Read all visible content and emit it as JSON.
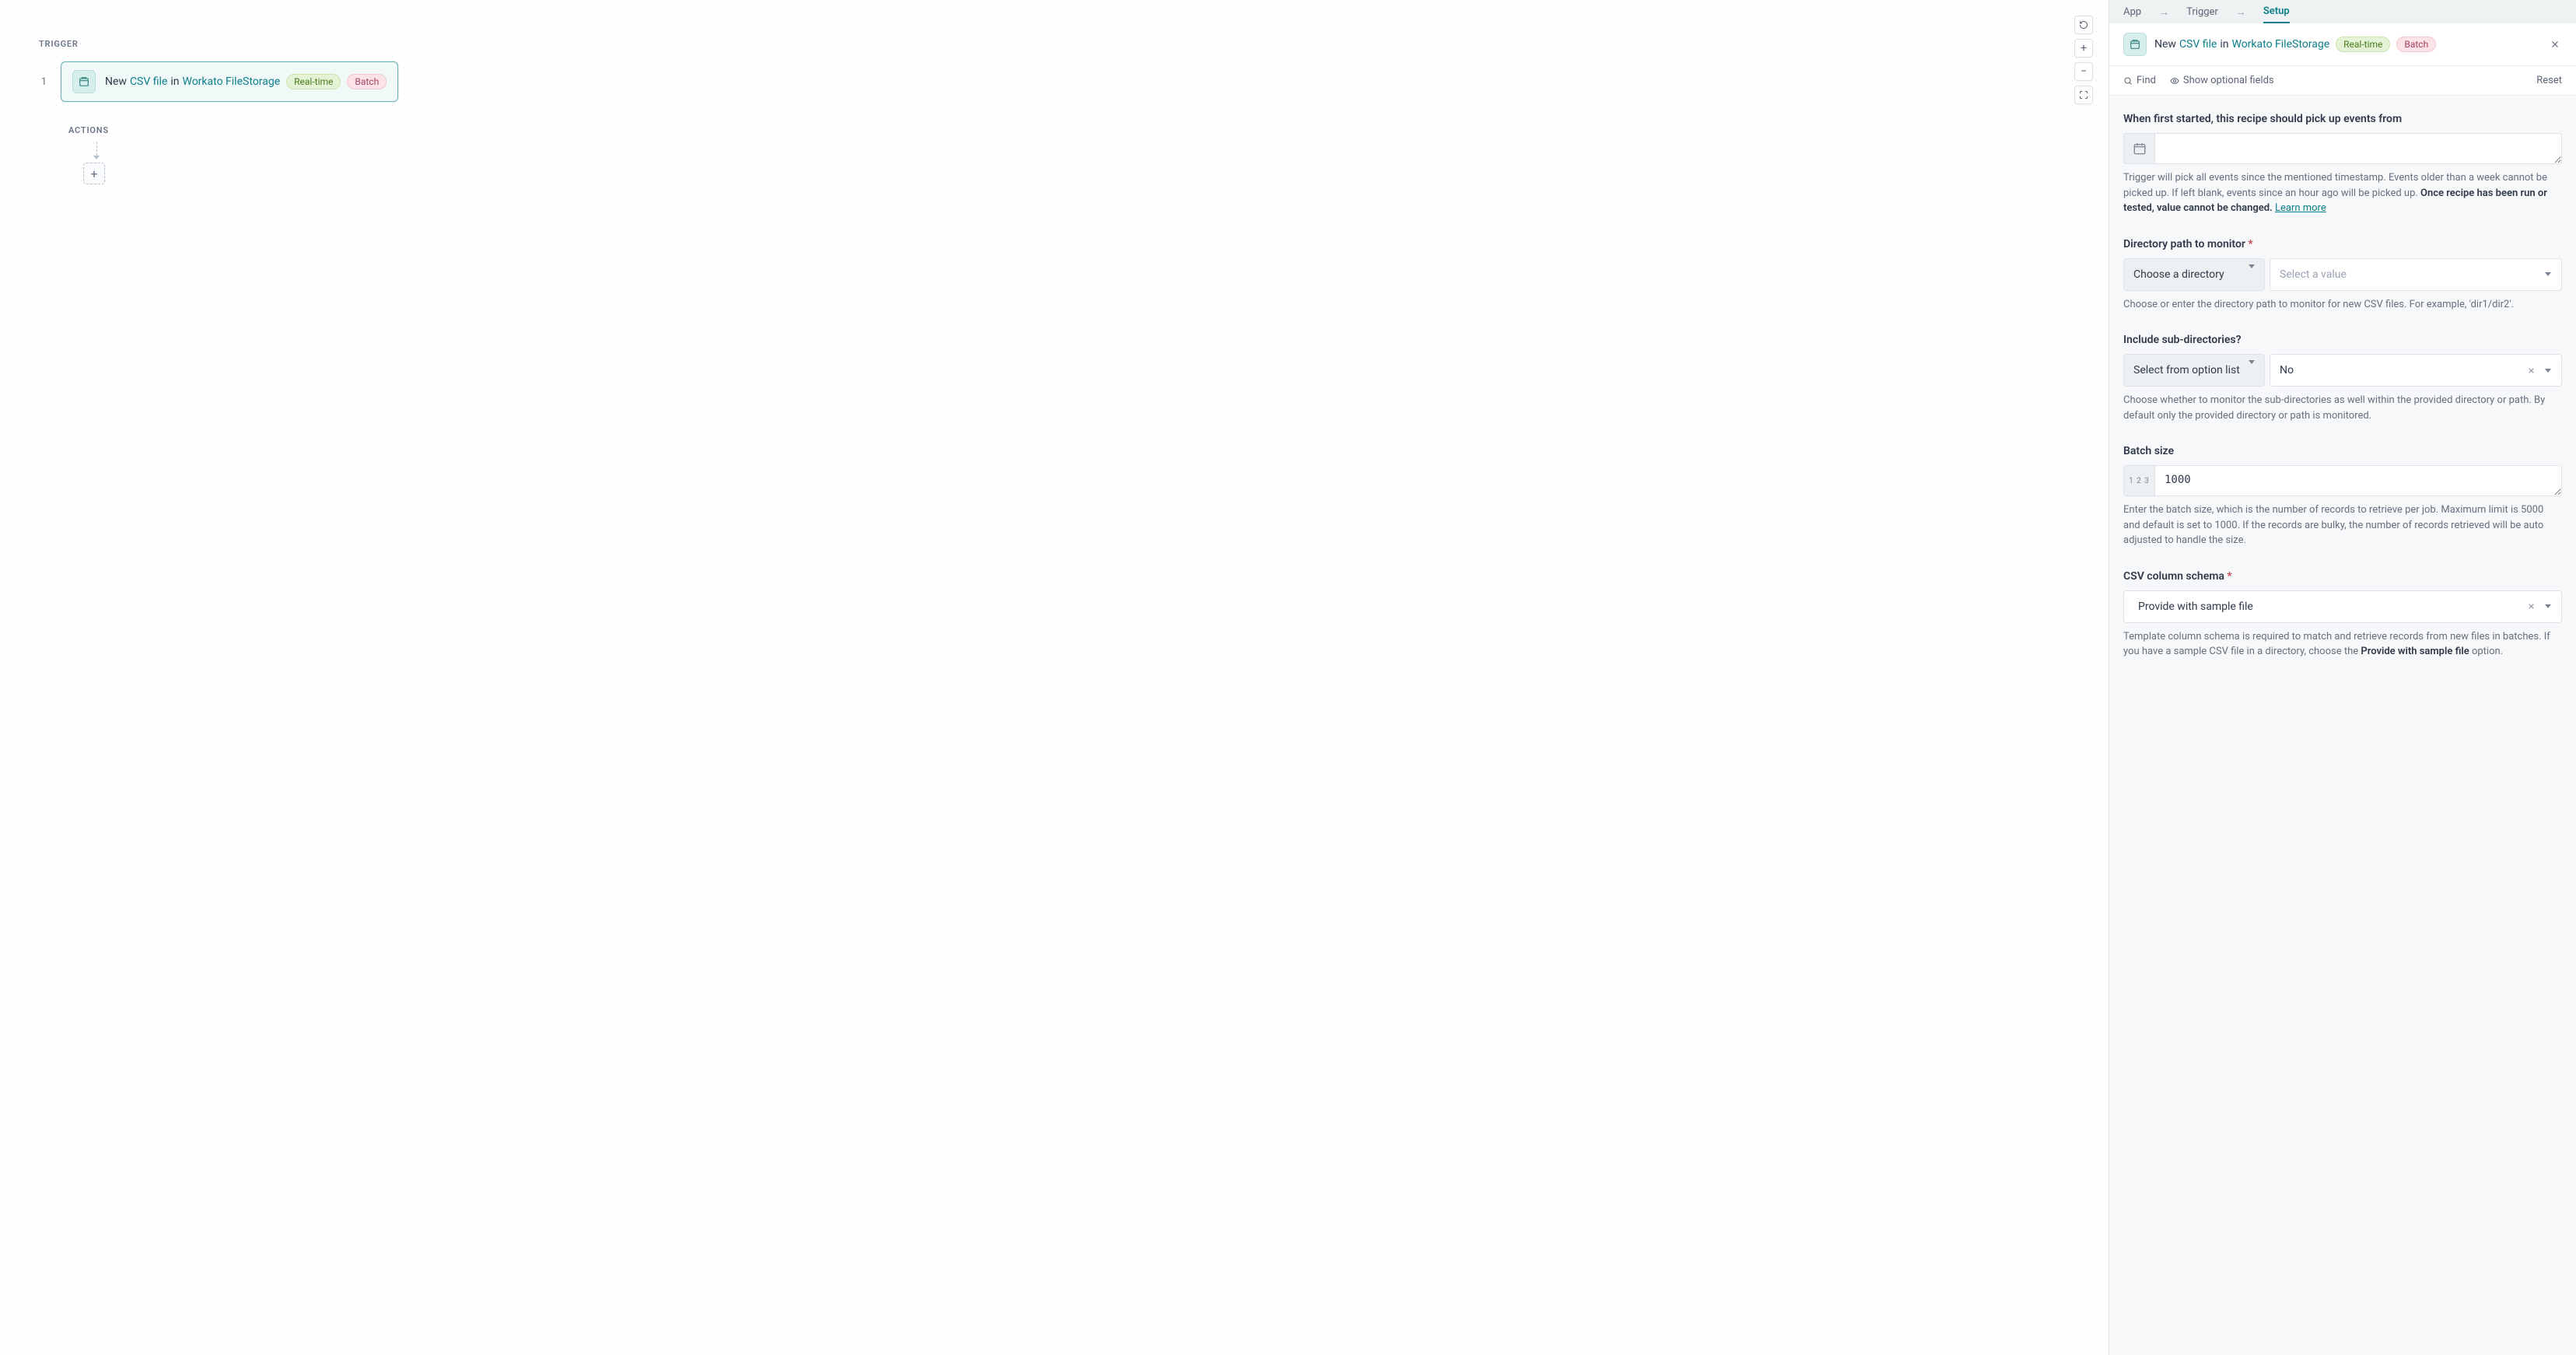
{
  "canvas": {
    "trigger_label": "TRIGGER",
    "actions_label": "ACTIONS",
    "step": {
      "num": "1",
      "prefix": "New",
      "link1": "CSV file",
      "middle": "in",
      "link2": "Workato FileStorage",
      "pill_realtime": "Real-time",
      "pill_batch": "Batch"
    },
    "add_plus": "+"
  },
  "panel": {
    "tabs": {
      "app": "App",
      "trigger": "Trigger",
      "setup": "Setup"
    },
    "header": {
      "prefix": "New",
      "link1": "CSV file",
      "middle": "in",
      "link2": "Workato FileStorage",
      "pill_realtime": "Real-time",
      "pill_batch": "Batch"
    },
    "toolbar": {
      "find": "Find",
      "optional": "Show optional fields",
      "reset": "Reset"
    },
    "fields": {
      "since": {
        "label": "When first started, this recipe should pick up events from",
        "help_pre": "Trigger will pick all events since the mentioned timestamp. Events older than a week cannot be picked up. If left blank, events since an hour ago will be picked up. ",
        "help_bold": "Once recipe has been run or tested, value cannot be changed.",
        "learn_more": "Learn more"
      },
      "dir": {
        "label": "Directory path to monitor",
        "button": "Choose a directory",
        "placeholder": "Select a value",
        "help": "Choose or enter the directory path to monitor for new CSV files. For example, 'dir1/dir2'."
      },
      "subdir": {
        "label": "Include sub-directories?",
        "button": "Select from option list",
        "value": "No",
        "help": "Choose whether to monitor the sub-directories as well within the provided directory or path. By default only the provided directory or path is monitored."
      },
      "batch": {
        "label": "Batch size",
        "prefix": "1 2 3",
        "value": "1000",
        "help": "Enter the batch size, which is the number of records to retrieve per job. Maximum limit is 5000 and default is set to 1000. If the records are bulky, the number of records retrieved will be auto adjusted to handle the size."
      },
      "schema": {
        "label": "CSV column schema",
        "value": "Provide with sample file",
        "help_pre": "Template column schema is required to match and retrieve records from new files in batches. If you have a sample CSV file in a directory, choose the ",
        "help_bold": "Provide with sample file",
        "help_post": " option."
      }
    }
  }
}
